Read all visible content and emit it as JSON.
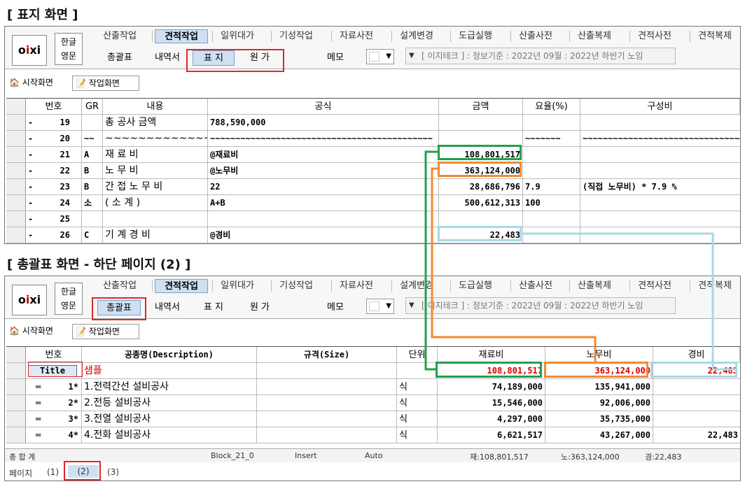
{
  "section1_title": "[ 표지 화면 ]",
  "section2_title": "[ 총괄표 화면 - 하단 페이지 (2) ]",
  "logo_text": "oixi",
  "lang": {
    "kor": "한글",
    "eng": "영문"
  },
  "menu": [
    "산출작업",
    "견적작업",
    "일위대가",
    "기성작업",
    "자료사전",
    "설계변경",
    "도급실행",
    "산출사전",
    "산출복제",
    "견적사전",
    "견적복제"
  ],
  "menu_active": "견적작업",
  "panel2_menu_last": "견적복제",
  "subtabs": {
    "summary": "총괄표",
    "detail": "내역서",
    "cover": "표 지",
    "original": "원 가"
  },
  "memo_label": "메모",
  "info_text": "[ 이지테크 ] : 정보기준 : 2022년 09월 : 2022년 하반기 노임",
  "work_tabs": {
    "start": "시작화면",
    "work": "작업화면"
  },
  "cover_table": {
    "headers": [
      "번호",
      "GR",
      "내용",
      "공식",
      "금액",
      "요율(%)",
      "구성비"
    ],
    "rows": [
      {
        "mark": "-",
        "no": "19",
        "gr": "",
        "content": "총 공사 금액",
        "formula": "788,590,000",
        "amount": "",
        "rate": "",
        "ratio": ""
      },
      {
        "mark": "-",
        "no": "20",
        "gr": "~~",
        "content": "~~~~~~~~~~~~~~~~~~~~~",
        "formula": "~~~~~~~~~~~~~~~~~~~~~~~~~~~~~~~~~~~~~~~~~~~~",
        "amount": "",
        "rate": "~~~~~~~",
        "ratio": "~~~~~~~~~~~~~~~~~~~~~~~~~~~~~~~~~~~"
      },
      {
        "mark": "-",
        "no": "21",
        "gr": "A",
        "content": "재   료   비",
        "formula": "@재료비",
        "amount": "108,801,517",
        "rate": "",
        "ratio": ""
      },
      {
        "mark": "-",
        "no": "22",
        "gr": "B",
        "content": "노   무   비",
        "formula": "@노무비",
        "amount": "363,124,000",
        "rate": "",
        "ratio": ""
      },
      {
        "mark": "-",
        "no": "23",
        "gr": "B",
        "content": "간 접 노 무 비",
        "formula": "22",
        "amount": "28,686,796",
        "rate": "7.9",
        "ratio": "(직접 노무비) * 7.9 %"
      },
      {
        "mark": "-",
        "no": "24",
        "gr": "소",
        "content": "( 소     계 )",
        "formula": "A+B",
        "amount": "500,612,313",
        "rate": "100",
        "ratio": ""
      },
      {
        "mark": "-",
        "no": "25",
        "gr": "",
        "content": "",
        "formula": "",
        "amount": "",
        "rate": "",
        "ratio": ""
      },
      {
        "mark": "-",
        "no": "26",
        "gr": "C",
        "content": "기  계  경  비",
        "formula": "@경비",
        "amount": "22,483",
        "rate": "",
        "ratio": ""
      }
    ]
  },
  "summary_table": {
    "headers": [
      "번호",
      "공종명(Description)",
      "규격(Size)",
      "단위",
      "재료비",
      "노무비",
      "경비"
    ],
    "title_row": {
      "no": "Title",
      "name": "샘플",
      "material": "108,801,517",
      "labor": "363,124,000",
      "expense": "22,483"
    },
    "rows": [
      {
        "mark": "═",
        "no": "1*",
        "name": "1.전력간선 설비공사",
        "unit": "식",
        "material": "74,189,000",
        "labor": "135,941,000",
        "expense": ""
      },
      {
        "mark": "═",
        "no": "2*",
        "name": "2.전등 설비공사",
        "unit": "식",
        "material": "15,546,000",
        "labor": "92,006,000",
        "expense": ""
      },
      {
        "mark": "═",
        "no": "3*",
        "name": "3.전열 설비공사",
        "unit": "식",
        "material": "4,297,000",
        "labor": "35,735,000",
        "expense": ""
      },
      {
        "mark": "═",
        "no": "4*",
        "name": "4.전화 설비공사",
        "unit": "식",
        "material": "6,621,517",
        "labor": "43,267,000",
        "expense": "22,483"
      }
    ]
  },
  "status": {
    "total": "총 합 계",
    "block": "Block_21_0",
    "mode": "Insert",
    "auto": "Auto",
    "material": "재:108,801,517",
    "labor": "노:363,124,000",
    "expense": "경:22,483"
  },
  "pages": {
    "label": "페이지",
    "p1": "(1)",
    "p2": "(2)",
    "p3": "(3)"
  },
  "colors": {
    "red": "#e0262b",
    "green": "#22a04b",
    "orange": "#f08a34",
    "lightblue": "#a7d8e6",
    "accent": "#cfe0f3"
  }
}
